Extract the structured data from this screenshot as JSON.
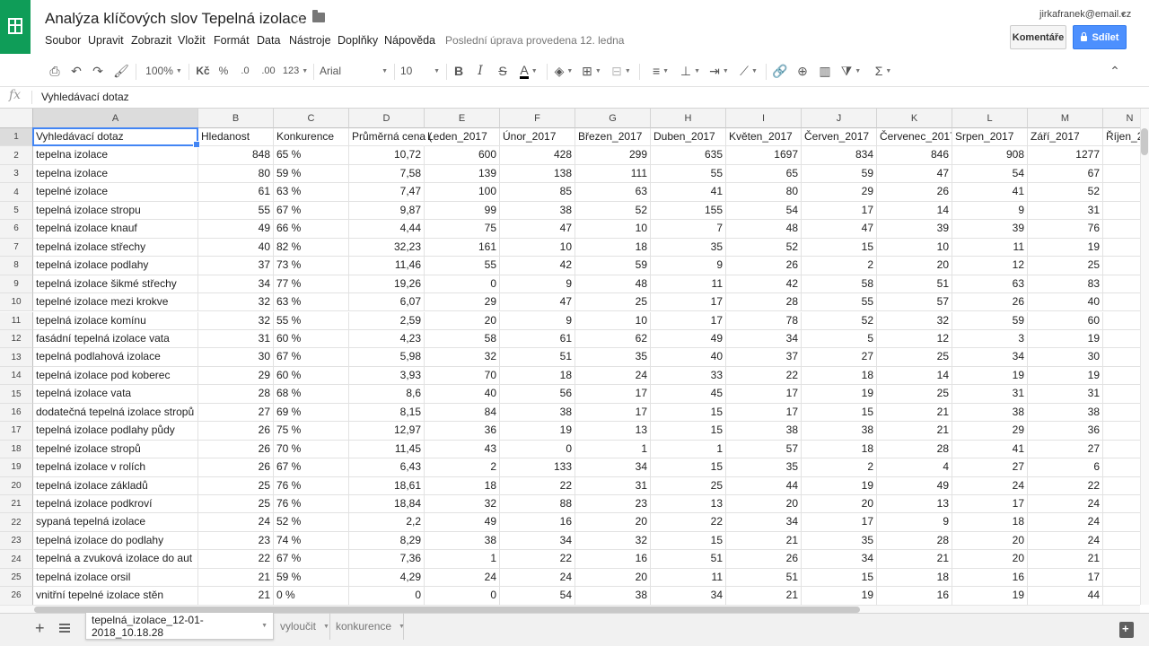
{
  "title": "Analýza klíčových slov Tepelná izolace",
  "menu": [
    "Soubor",
    "Upravit",
    "Zobrazit",
    "Vložit",
    "Formát",
    "Data",
    "Nástroje",
    "Doplňky",
    "Nápověda"
  ],
  "last_edit": "Poslední úprava provedena 12. ledna",
  "user_email": "jirkafranek@email.cz",
  "comments_label": "Komentáře",
  "share_label": "Sdílet",
  "toolbar": {
    "zoom": "100%",
    "currency": "Kč",
    "percent": "%",
    "decimal_decrease": ".0",
    "decimal_increase": ".00",
    "more_formats": "123",
    "font": "Arial",
    "font_size": "10",
    "bold": "B",
    "italic": "I",
    "strike": "S",
    "text_color": "A"
  },
  "formula": {
    "fx": "fx",
    "content": "Vyhledávací dotaz"
  },
  "columns": [
    "A",
    "B",
    "C",
    "D",
    "E",
    "F",
    "G",
    "H",
    "I",
    "J",
    "K",
    "L",
    "M",
    "N"
  ],
  "header_row": [
    "Vyhledávací dotaz",
    "Hledanost",
    "Konkurence",
    "Průměrná cena (",
    "Leden_2017",
    "Únor_2017",
    "Březen_2017",
    "Duben_2017",
    "Květen_2017",
    "Červen_2017",
    "Červenec_2017",
    "Srpen_2017",
    "Září_2017",
    "Říjen_2"
  ],
  "rows": [
    [
      "tepelna izolace",
      "848",
      "65 %",
      "10,72",
      "600",
      "428",
      "299",
      "635",
      "1697",
      "834",
      "846",
      "908",
      "1277",
      ""
    ],
    [
      "tepelna izolace",
      "80",
      "59 %",
      "7,58",
      "139",
      "138",
      "111",
      "55",
      "65",
      "59",
      "47",
      "54",
      "67",
      ""
    ],
    [
      "tepelné izolace",
      "61",
      "63 %",
      "7,47",
      "100",
      "85",
      "63",
      "41",
      "80",
      "29",
      "26",
      "41",
      "52",
      ""
    ],
    [
      "tepelná izolace stropu",
      "55",
      "67 %",
      "9,87",
      "99",
      "38",
      "52",
      "155",
      "54",
      "17",
      "14",
      "9",
      "31",
      ""
    ],
    [
      "tepelná izolace knauf",
      "49",
      "66 %",
      "4,44",
      "75",
      "47",
      "10",
      "7",
      "48",
      "47",
      "39",
      "39",
      "76",
      ""
    ],
    [
      "tepelná izolace střechy",
      "40",
      "82 %",
      "32,23",
      "161",
      "10",
      "18",
      "35",
      "52",
      "15",
      "10",
      "11",
      "19",
      ""
    ],
    [
      "tepelná izolace podlahy",
      "37",
      "73 %",
      "11,46",
      "55",
      "42",
      "59",
      "9",
      "26",
      "2",
      "20",
      "12",
      "25",
      ""
    ],
    [
      "tepelná izolace šikmé střechy",
      "34",
      "77 %",
      "19,26",
      "0",
      "9",
      "48",
      "11",
      "42",
      "58",
      "51",
      "63",
      "83",
      ""
    ],
    [
      "tepelné izolace mezi krokve",
      "32",
      "63 %",
      "6,07",
      "29",
      "47",
      "25",
      "17",
      "28",
      "55",
      "57",
      "26",
      "40",
      ""
    ],
    [
      "tepelná izolace komínu",
      "32",
      "55 %",
      "2,59",
      "20",
      "9",
      "10",
      "17",
      "78",
      "52",
      "32",
      "59",
      "60",
      ""
    ],
    [
      "fasádní tepelná izolace vata",
      "31",
      "60 %",
      "4,23",
      "58",
      "61",
      "62",
      "49",
      "34",
      "5",
      "12",
      "3",
      "19",
      ""
    ],
    [
      "tepelná podlahová izolace",
      "30",
      "67 %",
      "5,98",
      "32",
      "51",
      "35",
      "40",
      "37",
      "27",
      "25",
      "34",
      "30",
      ""
    ],
    [
      "tepelná izolace pod koberec",
      "29",
      "60 %",
      "3,93",
      "70",
      "18",
      "24",
      "33",
      "22",
      "18",
      "14",
      "19",
      "19",
      ""
    ],
    [
      "tepelná izolace vata",
      "28",
      "68 %",
      "8,6",
      "40",
      "56",
      "17",
      "45",
      "17",
      "19",
      "25",
      "31",
      "31",
      ""
    ],
    [
      "dodatečná tepelná izolace stropů",
      "27",
      "69 %",
      "8,15",
      "84",
      "38",
      "17",
      "15",
      "17",
      "15",
      "21",
      "38",
      "38",
      ""
    ],
    [
      "tepelná izolace podlahy půdy",
      "26",
      "75 %",
      "12,97",
      "36",
      "19",
      "13",
      "15",
      "38",
      "38",
      "21",
      "29",
      "36",
      ""
    ],
    [
      "tepelné izolace stropů",
      "26",
      "70 %",
      "11,45",
      "43",
      "0",
      "1",
      "1",
      "57",
      "18",
      "28",
      "41",
      "27",
      ""
    ],
    [
      "tepelná izolace v rolích",
      "26",
      "67 %",
      "6,43",
      "2",
      "133",
      "34",
      "15",
      "35",
      "2",
      "4",
      "27",
      "6",
      ""
    ],
    [
      "tepelná izolace základů",
      "25",
      "76 %",
      "18,61",
      "18",
      "22",
      "31",
      "25",
      "44",
      "19",
      "49",
      "24",
      "22",
      ""
    ],
    [
      "tepelná izolace podkroví",
      "25",
      "76 %",
      "18,84",
      "32",
      "88",
      "23",
      "13",
      "20",
      "20",
      "13",
      "17",
      "24",
      ""
    ],
    [
      "sypaná tepelná izolace",
      "24",
      "52 %",
      "2,2",
      "49",
      "16",
      "20",
      "22",
      "34",
      "17",
      "9",
      "18",
      "24",
      ""
    ],
    [
      "tepelná izolace do podlahy",
      "23",
      "74 %",
      "8,29",
      "38",
      "34",
      "32",
      "15",
      "21",
      "35",
      "28",
      "20",
      "24",
      ""
    ],
    [
      "tepelná a zvuková izolace do aut",
      "22",
      "67 %",
      "7,36",
      "1",
      "22",
      "16",
      "51",
      "26",
      "34",
      "21",
      "20",
      "21",
      ""
    ],
    [
      "tepelná izolace orsil",
      "21",
      "59 %",
      "4,29",
      "24",
      "24",
      "20",
      "11",
      "51",
      "15",
      "18",
      "16",
      "17",
      ""
    ],
    [
      "vnitřní tepelné izolace stěn",
      "21",
      "0 %",
      "0",
      "0",
      "54",
      "38",
      "34",
      "21",
      "19",
      "16",
      "19",
      "44",
      ""
    ]
  ],
  "sheet_tabs": [
    "tepelná_izolace_12-01-2018_10.18.28",
    "vyloučit",
    "konkurence"
  ],
  "colors": {
    "brand_green": "#0f9d58",
    "share_blue": "#4d90fe",
    "selection_blue": "#4285f4"
  }
}
